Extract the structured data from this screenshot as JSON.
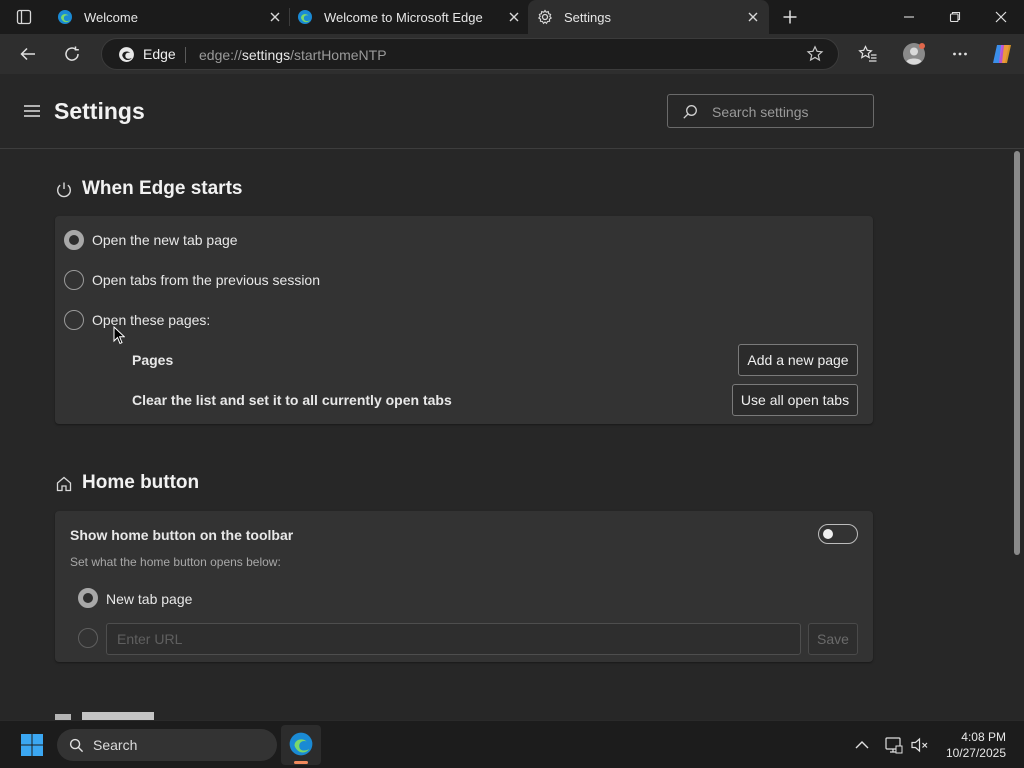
{
  "tabs": [
    {
      "title": "Welcome",
      "favicon": "edge-icon",
      "active": false
    },
    {
      "title": "Welcome to Microsoft Edge",
      "favicon": "edge-icon",
      "active": false
    },
    {
      "title": "Settings",
      "favicon": "gear-icon",
      "active": true
    }
  ],
  "omnibox": {
    "site_label": "Edge",
    "url_prefix": "edge://",
    "url_host": "settings",
    "url_path": "/startHomeNTP"
  },
  "header": {
    "title": "Settings",
    "search_placeholder": "Search settings"
  },
  "startup": {
    "title": "When Edge starts",
    "options": [
      {
        "label": "Open the new tab page",
        "selected": true
      },
      {
        "label": "Open tabs from the previous session",
        "selected": false
      },
      {
        "label": "Open these pages:",
        "selected": false
      }
    ],
    "pages_label": "Pages",
    "add_page_button": "Add a new page",
    "clear_label": "Clear the list and set it to all currently open tabs",
    "use_open_tabs_button": "Use all open tabs"
  },
  "home": {
    "title": "Home button",
    "toggle_label": "Show home button on the toolbar",
    "toggle_on": false,
    "hint": "Set what the home button opens below:",
    "option_new_tab": "New tab page",
    "url_placeholder": "Enter URL",
    "save_button": "Save"
  },
  "taskbar": {
    "search_label": "Search",
    "time": "4:08 PM",
    "date": "10/27/2025"
  },
  "colors": {
    "accent_taskbar_indicator": "#f08a5d",
    "page_background": "#272727",
    "card_background": "#333333"
  }
}
